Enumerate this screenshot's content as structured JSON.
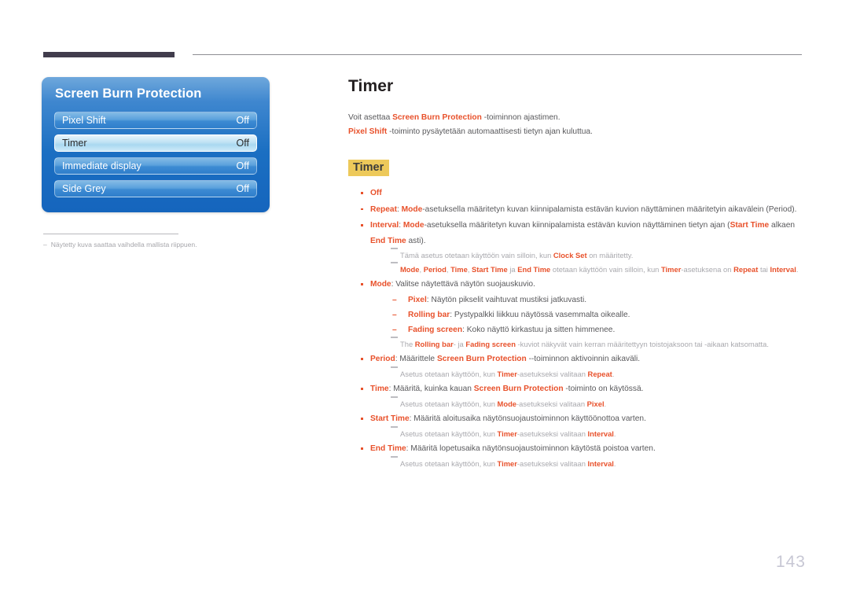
{
  "header": {
    "rule_left": "dark-bar",
    "rule_right": "thin-line"
  },
  "osd": {
    "title": "Screen Burn Protection",
    "rows": [
      {
        "label": "Pixel Shift",
        "value": "Off",
        "selected": false
      },
      {
        "label": "Timer",
        "value": "Off",
        "selected": true
      },
      {
        "label": "Immediate display",
        "value": "Off",
        "selected": false
      },
      {
        "label": "Side Grey",
        "value": "Off",
        "selected": false
      }
    ]
  },
  "figure_note": {
    "dash": "–",
    "text": "Näytetty kuva saattaa vaihdella mallista riippuen."
  },
  "content": {
    "title": "Timer",
    "intro_1": {
      "pre": "Voit asettaa ",
      "term": "Screen Burn Protection",
      "post": " -toiminnon ajastimen."
    },
    "intro_2": {
      "term": "Pixel Shift",
      "post": " -toiminto pysäytetään automaattisesti tietyn ajan kuluttua."
    },
    "section_heading": "Timer",
    "bullets": {
      "off": "Off",
      "repeat": {
        "term": "Repeat",
        "sep": ": ",
        "term2": "Mode",
        "rest": "-asetuksella määritetyn kuvan kiinnipalamista estävän kuvion näyttäminen määritetyin aikavälein (Period)."
      },
      "interval": {
        "term": "Interval",
        "sep": ": ",
        "term2": "Mode",
        "rest": "-asetuksella määritetyn kuvan kiinnipalamista estävän kuvion näyttäminen tietyn ajan (",
        "term3": "Start Time",
        "mid": " alkaen ",
        "term4": "End Time",
        "tail": " asti)."
      },
      "note_clock": {
        "pre": "Tämä asetus otetaan käyttöön vain silloin, kun ",
        "term": "Clock Set",
        "post": " on määritetty."
      },
      "note_modes": {
        "t1": "Mode",
        "c1": ", ",
        "t2": "Period",
        "c2": ", ",
        "t3": "Time",
        "c3": ", ",
        "t4": "Start Time",
        "ja": " ja ",
        "t5": "End Time",
        "mid": " otetaan käyttöön vain silloin, kun ",
        "t6": "Timer",
        "mid2": "-asetuksena on ",
        "t7": "Repeat",
        "tai": " tai ",
        "t8": "Interval",
        "end": "."
      },
      "mode": {
        "term": "Mode",
        "rest": ": Valitse näytettävä näytön suojauskuvio."
      },
      "mode_subs": [
        {
          "dash": "–",
          "term": "Pixel",
          "rest": ": Näytön pikselit vaihtuvat mustiksi jatkuvasti."
        },
        {
          "dash": "–",
          "term": "Rolling bar",
          "rest": ": Pystypalkki liikkuu näytössä vasemmalta oikealle."
        },
        {
          "dash": "–",
          "term": "Fading screen",
          "rest": ": Koko näyttö kirkastuu ja sitten himmenee."
        }
      ],
      "note_rolling": {
        "pre": "The ",
        "t1": "Rolling bar",
        "mid": "- ja ",
        "t2": "Fading screen",
        "post": " -kuviot näkyvät vain kerran määritettyyn toistojaksoon tai -aikaan katsomatta."
      },
      "period": {
        "term": "Period",
        "mid": ": Määrittele ",
        "term2": "Screen Burn Protection",
        "rest": " --toiminnon aktivoinnin aikaväli."
      },
      "note_period": {
        "pre": "Asetus otetaan käyttöön, kun ",
        "t1": "Timer",
        "mid": "-asetukseksi valitaan ",
        "t2": "Repeat",
        "end": "."
      },
      "time": {
        "term": "Time",
        "mid": ": Määritä, kuinka kauan ",
        "term2": "Screen Burn Protection",
        "rest": " -toiminto on käytössä."
      },
      "note_time": {
        "pre": "Asetus otetaan käyttöön, kun ",
        "t1": "Mode",
        "mid": "-asetukseksi valitaan ",
        "t2": "Pixel",
        "end": "."
      },
      "start_time": {
        "term": "Start Time",
        "rest": ": Määritä aloitusaika näytönsuojaustoiminnon käyttöönottoa varten."
      },
      "note_start": {
        "pre": "Asetus otetaan käyttöön, kun ",
        "t1": "Timer",
        "mid": "-asetukseksi valitaan ",
        "t2": "Interval",
        "end": "."
      },
      "end_time": {
        "term": "End Time",
        "rest": ": Määritä lopetusaika näytönsuojaustoiminnon käytöstä poistoa varten."
      },
      "note_end": {
        "pre": "Asetus otetaan käyttöön, kun ",
        "t1": "Timer",
        "mid": "-asetukseksi valitaan ",
        "t2": "Interval",
        "end": "."
      }
    }
  },
  "page_number": "143",
  "colors": {
    "accent_orange": "#e8512b",
    "highlight_gold": "#edc95a",
    "osd_blue": "#1b6fc2",
    "note_gray": "#a9a9ae",
    "header_dark": "#413c4c"
  }
}
